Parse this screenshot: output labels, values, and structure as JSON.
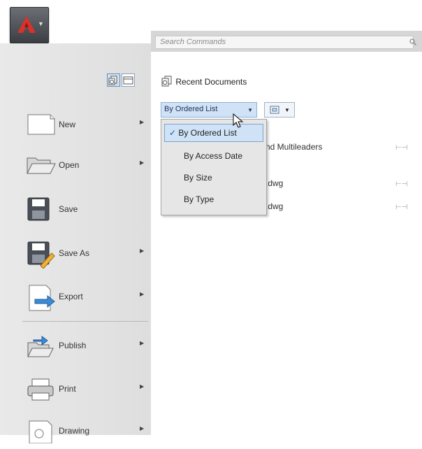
{
  "search": {
    "placeholder": "Search Commands"
  },
  "menu": {
    "items": [
      {
        "label": "New",
        "has_submenu": true,
        "icon": "new-file-icon"
      },
      {
        "label": "Open",
        "has_submenu": true,
        "icon": "folder-open-icon"
      },
      {
        "label": "Save",
        "has_submenu": false,
        "icon": "floppy-disk-icon"
      },
      {
        "label": "Save As",
        "has_submenu": true,
        "icon": "save-as-icon"
      },
      {
        "label": "Export",
        "has_submenu": true,
        "icon": "export-icon"
      },
      {
        "label": "Publish",
        "has_submenu": true,
        "icon": "publish-icon"
      },
      {
        "label": "Print",
        "has_submenu": true,
        "icon": "printer-icon"
      },
      {
        "label": "Drawing",
        "has_submenu": true,
        "icon": "drawing-utilities-icon"
      }
    ]
  },
  "recent": {
    "header": "Recent Documents",
    "order_select": {
      "value": "By Ordered List"
    },
    "order_options": [
      {
        "label": "By Ordered List",
        "selected": true
      },
      {
        "label": "By Access Date",
        "selected": false
      },
      {
        "label": "By Size",
        "selected": false
      },
      {
        "label": "By Type",
        "selected": false
      }
    ],
    "documents": [
      {
        "name": "nd Multileaders"
      },
      {
        "name": ".dwg"
      },
      {
        "name": ".dwg"
      }
    ]
  },
  "colors": {
    "app_logo_red": "#d8322c",
    "selection_blue": "#cfe2f6"
  }
}
